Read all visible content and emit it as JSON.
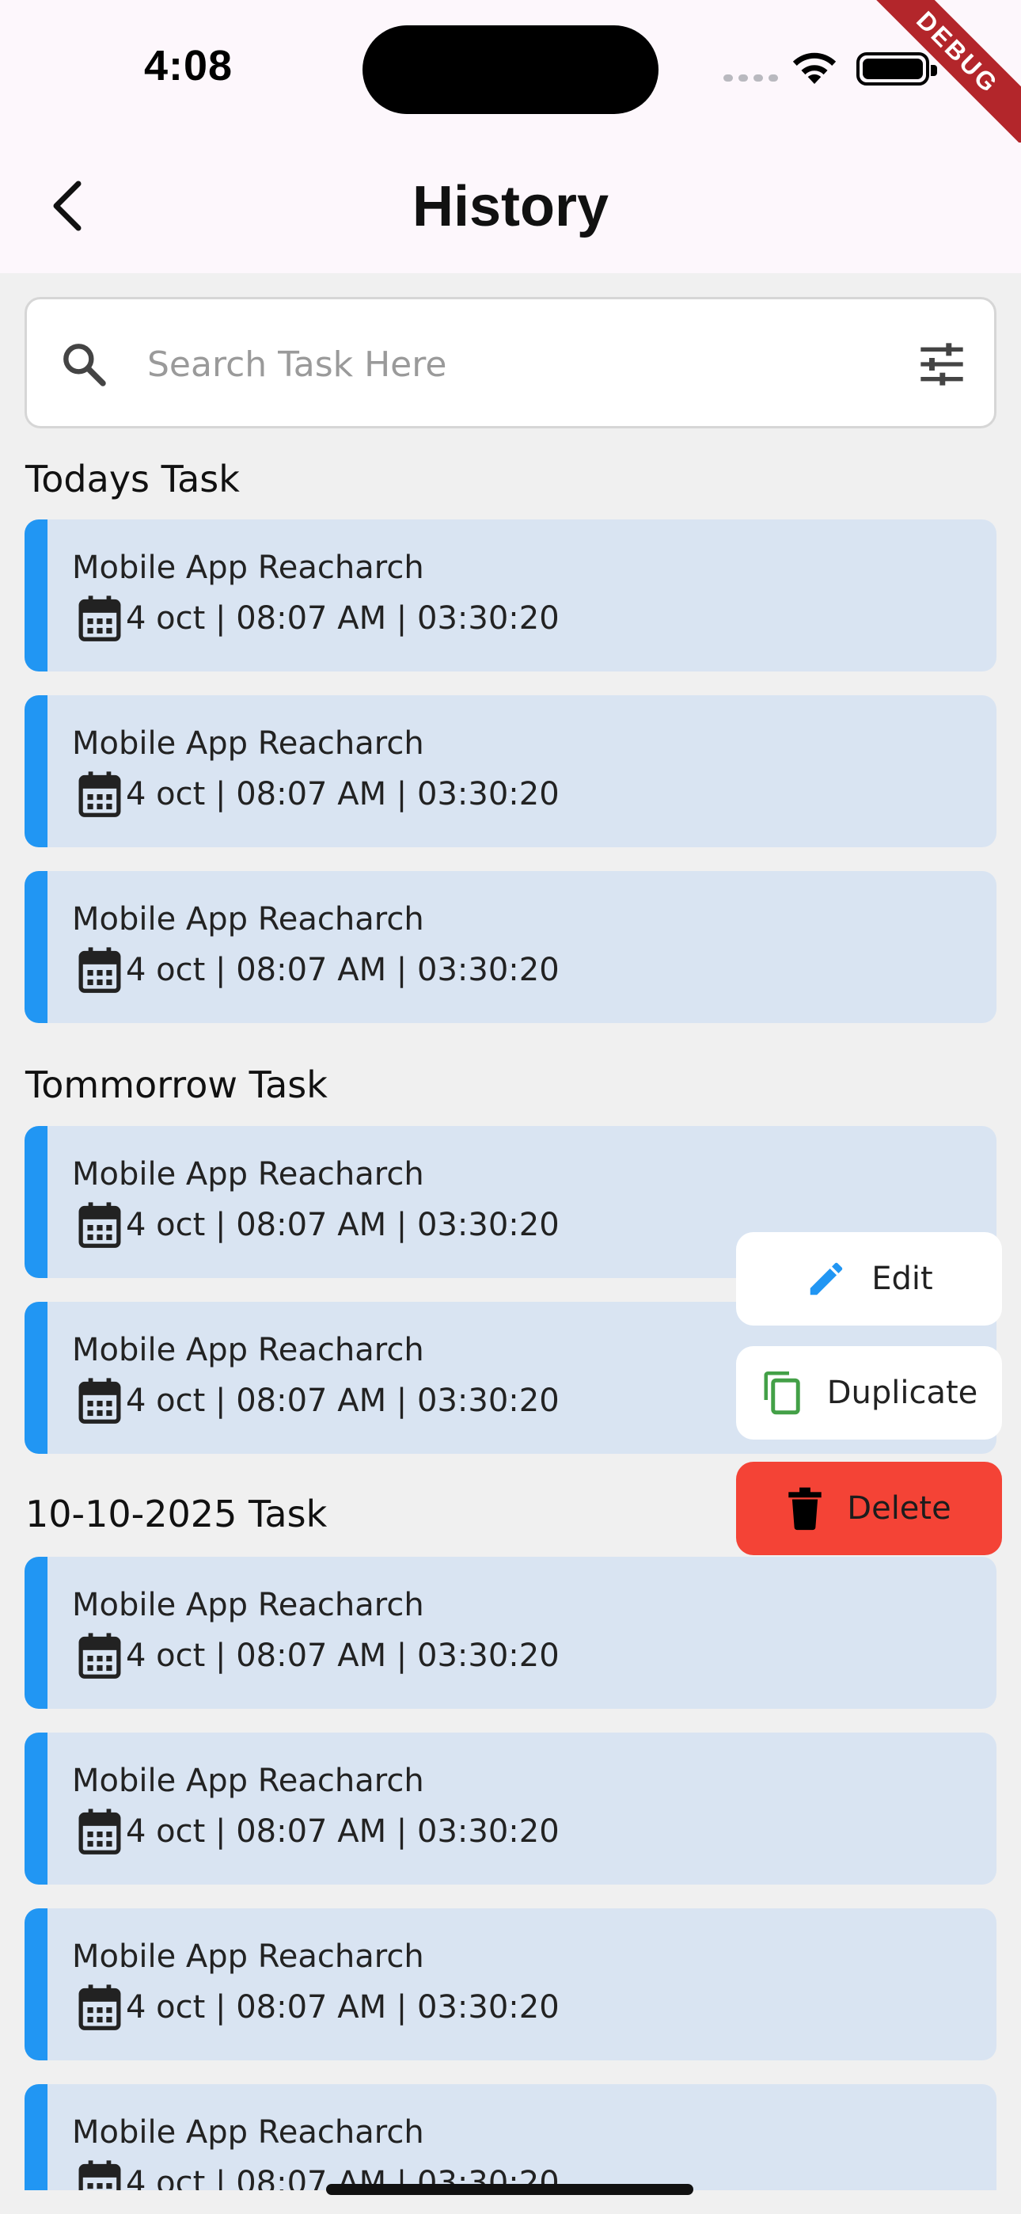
{
  "status": {
    "time": "4:08"
  },
  "debug_banner": "DEBUG",
  "header": {
    "title": "History"
  },
  "search": {
    "placeholder": "Search Task Here"
  },
  "sections": [
    {
      "title": "Todays Task",
      "tasks": [
        {
          "title": "Mobile App Reacharch",
          "meta": "4 oct | 08:07 AM | 03:30:20"
        },
        {
          "title": "Mobile App Reacharch",
          "meta": "4 oct | 08:07 AM | 03:30:20"
        },
        {
          "title": "Mobile App Reacharch",
          "meta": "4 oct | 08:07 AM | 03:30:20"
        }
      ]
    },
    {
      "title": "Tommorrow Task",
      "tasks": [
        {
          "title": "Mobile App Reacharch",
          "meta": "4 oct | 08:07 AM | 03:30:20"
        },
        {
          "title": "Mobile App Reacharch",
          "meta": "4 oct | 08:07 AM | 03:30:20"
        }
      ]
    },
    {
      "title": "10-10-2025 Task",
      "tasks": [
        {
          "title": "Mobile App Reacharch",
          "meta": "4 oct | 08:07 AM | 03:30:20"
        },
        {
          "title": "Mobile App Reacharch",
          "meta": "4 oct | 08:07 AM | 03:30:20"
        },
        {
          "title": "Mobile App Reacharch",
          "meta": "4 oct | 08:07 AM | 03:30:20"
        },
        {
          "title": "Mobile App Reacharch",
          "meta": "4 oct | 08:07 AM | 03:30:20"
        }
      ]
    }
  ],
  "context_menu": {
    "edit_label": "Edit",
    "duplicate_label": "Duplicate",
    "delete_label": "Delete"
  },
  "colors": {
    "accent": "#2196f3",
    "card_bg": "#d9e4f2",
    "delete_bg": "#f44336",
    "duplicate_icon": "#43a047"
  },
  "icons": [
    "back-arrow-icon",
    "search-icon",
    "filter-icon",
    "calendar-icon",
    "pencil-icon",
    "copy-icon",
    "trash-icon"
  ]
}
